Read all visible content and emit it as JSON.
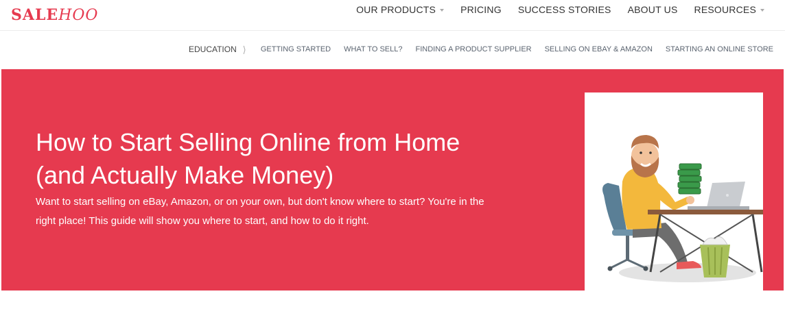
{
  "brand": {
    "logo_part1": "SALE",
    "logo_part2": "HOO"
  },
  "main_nav": [
    {
      "label": "OUR PRODUCTS",
      "dropdown": true
    },
    {
      "label": "PRICING",
      "dropdown": false
    },
    {
      "label": "SUCCESS STORIES",
      "dropdown": false
    },
    {
      "label": "ABOUT US",
      "dropdown": false
    },
    {
      "label": "RESOURCES",
      "dropdown": true
    }
  ],
  "sub_nav": {
    "section": "EDUCATION",
    "items": [
      "GETTING STARTED",
      "WHAT TO SELL?",
      "FINDING A PRODUCT SUPPLIER",
      "SELLING ON EBAY & AMAZON",
      "STARTING AN ONLINE STORE"
    ]
  },
  "hero": {
    "title": "How to Start Selling Online from Home (and Actually Make Money)",
    "subtitle": "Want to start selling on eBay, Amazon, or on your own, but don't know where to start? You're in the right place! This guide will show you where to start, and how to do it right.",
    "illustration_icon": "man-with-money-laptop-illustration"
  },
  "colors": {
    "accent": "#e63a4f",
    "text_dark": "#333333"
  }
}
